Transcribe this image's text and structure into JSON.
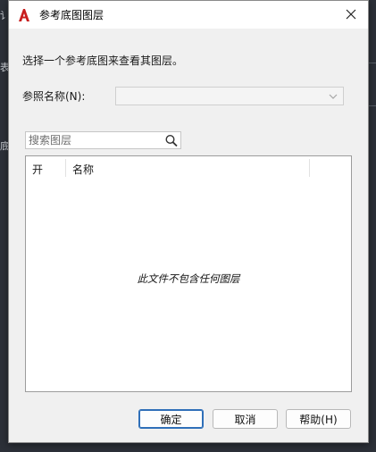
{
  "background": {
    "left_fragments": [
      "讠",
      "表",
      "底"
    ]
  },
  "dialog": {
    "title": "参考底图图层",
    "icon": "autocad-a-icon",
    "accent_color": "#c81e1e",
    "instruction": "选择一个参考底图来查看其图层。",
    "ref_name_label": "参照名称(N):",
    "ref_name_value": "",
    "search": {
      "placeholder": "搜索图层",
      "value": ""
    },
    "list": {
      "columns": [
        "开",
        "名称"
      ],
      "empty_message": "此文件不包含任何图层"
    },
    "buttons": {
      "ok": "确定",
      "cancel": "取消",
      "help": "帮助(H)"
    }
  }
}
